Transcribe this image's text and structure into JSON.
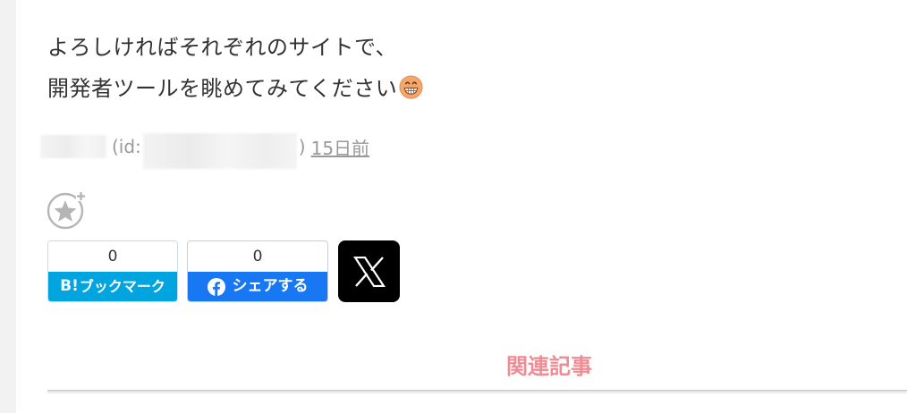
{
  "article": {
    "line1": "よろしければそれぞれのサイトで、",
    "line2": "開発者ツールを眺めてみてください",
    "emoji_icon": "grinning-face-emoji"
  },
  "meta": {
    "id_open": "(id:",
    "id_close": ")",
    "date": "15日前"
  },
  "star_icon": "add-star-icon",
  "share": {
    "hatena": {
      "count": "0",
      "logo": "B!",
      "label": "ブックマーク",
      "color": "#00a4de"
    },
    "facebook": {
      "count": "0",
      "label": "シェアする",
      "color": "#1877f2"
    },
    "x": {
      "icon": "x-logo-icon",
      "color": "#000000"
    }
  },
  "related": {
    "title": "関連記事",
    "color": "#f08b93"
  }
}
